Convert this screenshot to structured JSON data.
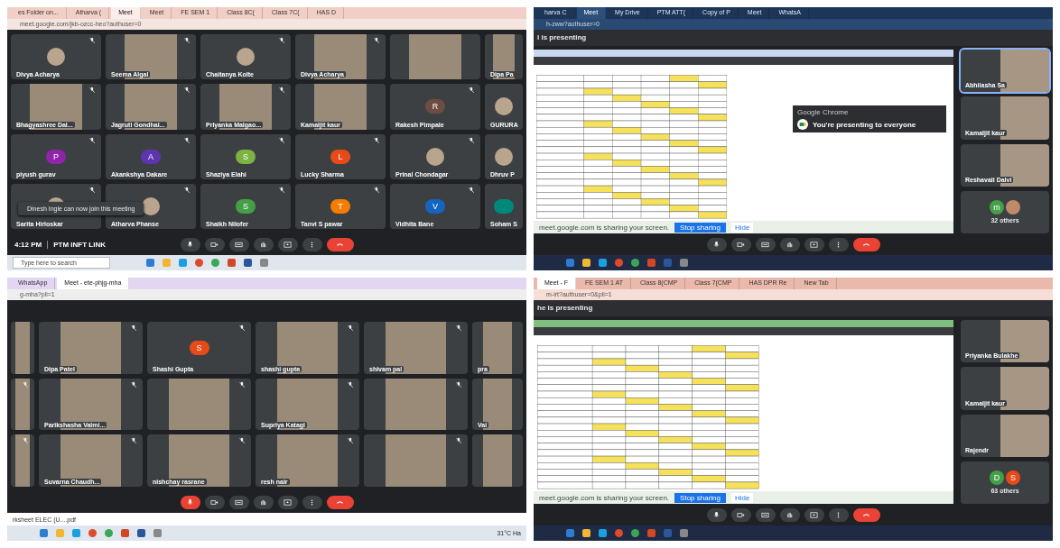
{
  "panels": [
    {
      "kind": "grid",
      "tabs": [
        {
          "label": "es Folder on...",
          "selected": false
        },
        {
          "label": "Atharva (",
          "selected": false
        },
        {
          "label": "Meet",
          "selected": true
        },
        {
          "label": "Meet",
          "selected": false
        },
        {
          "label": "FE SEM 1",
          "selected": false
        },
        {
          "label": "Class 8C(",
          "selected": false
        },
        {
          "label": "Class 7C(",
          "selected": false
        },
        {
          "label": "HAS D",
          "selected": false
        }
      ],
      "url": "meet.google.com/jkb-ozcc-heo?authuser=0",
      "mic_muted": false,
      "tiles": [
        {
          "name": "Divya Acharya",
          "kind": "picture",
          "muted": true
        },
        {
          "name": "Seema Algal",
          "kind": "video",
          "muted": true
        },
        {
          "name": "Chaitanya Kolte",
          "kind": "picture",
          "muted": true
        },
        {
          "name": "Divya Acharya",
          "kind": "video",
          "muted": true
        },
        {
          "kind": "video",
          "muted": false
        },
        {
          "name": "Dipa Pa",
          "kind": "video",
          "muted": false
        },
        {
          "name": "Bhagyashree Dal...",
          "kind": "video",
          "muted": true
        },
        {
          "name": "Jagruti Gondhal...",
          "kind": "video",
          "muted": true
        },
        {
          "name": "Priyanka Malgao...",
          "kind": "video",
          "muted": true
        },
        {
          "name": "Kamaljit kaur",
          "kind": "video",
          "muted": false
        },
        {
          "name": "Rakesh Pimpale",
          "kind": "initial",
          "letter": "R",
          "color": "#6d4c41",
          "muted": true
        },
        {
          "name": "GURURA",
          "kind": "picture",
          "muted": false
        },
        {
          "name": "piyush gurav",
          "kind": "initial",
          "letter": "P",
          "color": "#8e24aa",
          "muted": true
        },
        {
          "name": "Akankshya Dakare",
          "kind": "initial",
          "letter": "A",
          "color": "#5e35b1",
          "muted": true
        },
        {
          "name": "Shaziya Elahi",
          "kind": "initial",
          "letter": "S",
          "color": "#7cb342",
          "muted": true
        },
        {
          "name": "Lucky Sharma",
          "kind": "initial",
          "letter": "L",
          "color": "#e64a19",
          "muted": true
        },
        {
          "name": "Prinal Chondagar",
          "kind": "picture",
          "muted": true
        },
        {
          "name": "Dhruv P",
          "kind": "picture",
          "muted": false
        },
        {
          "name": "Sarita Hirloskar",
          "kind": "picture",
          "muted": true
        },
        {
          "name": "Atharva Phanse",
          "kind": "picture",
          "muted": true
        },
        {
          "name": "Shaikh Nilofer",
          "kind": "initial",
          "letter": "S",
          "color": "#43a047",
          "muted": true
        },
        {
          "name": "Tanvi S pawar",
          "kind": "initial",
          "letter": "T",
          "color": "#f57c00",
          "muted": true
        },
        {
          "name": "Vidhita Bane",
          "kind": "initial",
          "letter": "V",
          "color": "#1565c0",
          "muted": true
        },
        {
          "name": "Soham S",
          "kind": "initial",
          "color": "#00897b",
          "muted": false
        }
      ],
      "toast": "Dinesh Ingle can now join this meeting",
      "info": {
        "time": "4:12 PM",
        "title": "PTM INFT LINK"
      },
      "taskbar": {
        "search_placeholder": "Type here to search"
      }
    },
    {
      "kind": "presenting",
      "tabs": [
        {
          "label": "harva C",
          "selected": false
        },
        {
          "label": "Meet",
          "selected": true
        },
        {
          "label": "My Drive",
          "selected": false
        },
        {
          "label": "PTM ATT(",
          "selected": false
        },
        {
          "label": "Copy of P",
          "selected": false
        },
        {
          "label": "Meet",
          "selected": false
        },
        {
          "label": "WhatsA",
          "selected": false
        }
      ],
      "url": "h-zww?authuser=0",
      "mic_muted": false,
      "presenter": "l is presenting",
      "side_tiles": [
        {
          "name": "Abhilasha Sa",
          "speaking": true
        },
        {
          "name": "Kamaljit kaur",
          "speaking": false
        },
        {
          "name": "Reshavali Dalvi",
          "speaking": false
        }
      ],
      "others": {
        "avatars": [
          {
            "kind": "initial",
            "letter": "m",
            "color": "#43a047"
          },
          {
            "kind": "picture"
          }
        ],
        "label": "32 others"
      },
      "notification": {
        "app": "Google Chrome",
        "title": "You're presenting to everyone"
      },
      "share_bar": {
        "message": "meet.google.com is sharing your screen.",
        "stop": "Stop sharing",
        "hide": "Hide"
      }
    },
    {
      "kind": "grid",
      "tabs": [
        {
          "label": "WhatsApp",
          "selected": false
        },
        {
          "label": "Meet - ete-phjg-mha",
          "selected": true
        }
      ],
      "url": "g-mha?pli=1",
      "mic_muted": true,
      "tiles": [
        {
          "kind": "video",
          "muted": false
        },
        {
          "name": "Dipa Patel",
          "kind": "video",
          "muted": true
        },
        {
          "name": "Shashi Gupta",
          "kind": "initial",
          "letter": "S",
          "color": "#e64a19",
          "muted": true
        },
        {
          "name": "shashi gupta",
          "kind": "video",
          "muted": true
        },
        {
          "name": "shivam pal",
          "kind": "video",
          "muted": true
        },
        {
          "name": "pra",
          "kind": "video",
          "muted": false
        },
        {
          "kind": "video",
          "muted": true
        },
        {
          "name": "Parikshasha Valmi...",
          "kind": "video",
          "muted": true
        },
        {
          "kind": "video",
          "muted": true
        },
        {
          "name": "Supriya Katagi",
          "kind": "video",
          "muted": true
        },
        {
          "kind": "video",
          "muted": true
        },
        {
          "name": "Vai",
          "kind": "video",
          "muted": false
        },
        {
          "kind": "video",
          "muted": true
        },
        {
          "name": "Suvarna Chaudh...",
          "kind": "video",
          "muted": true
        },
        {
          "name": "nishchay rasrane",
          "kind": "video",
          "muted": true
        },
        {
          "name": "resh nair",
          "kind": "video",
          "muted": true
        },
        {
          "kind": "video",
          "muted": true
        },
        {
          "kind": "video",
          "muted": false
        }
      ],
      "download": "rksheet ELEC (U....pdf",
      "taskbar": {
        "weather": "31°C Ha"
      }
    },
    {
      "kind": "presenting",
      "tabs": [
        {
          "label": "Meet - F",
          "selected": true
        },
        {
          "label": "FE SEM 1 AT",
          "selected": false
        },
        {
          "label": "Class 8(CMP",
          "selected": false
        },
        {
          "label": "Class 7(CMP",
          "selected": false
        },
        {
          "label": "HAS DPR Re",
          "selected": false
        },
        {
          "label": "New Tab",
          "selected": false
        }
      ],
      "url": "m-irt?authuser=0&pli=1",
      "mic_muted": false,
      "presenter": "he is presenting",
      "side_tiles": [
        {
          "name": "Priyanka Bulakhe",
          "speaking": false
        },
        {
          "name": "Kamaljit kaur",
          "speaking": false
        },
        {
          "name": "Rajendr",
          "speaking": false
        }
      ],
      "others": {
        "avatars": [
          {
            "kind": "initial",
            "letter": "D",
            "color": "#43a047"
          },
          {
            "kind": "initial",
            "letter": "S",
            "color": "#e64a19"
          }
        ],
        "label": "63 others"
      },
      "share_bar": {
        "message": "meet.google.com is sharing your screen.",
        "stop": "Stop sharing",
        "hide": "Hide"
      }
    }
  ]
}
